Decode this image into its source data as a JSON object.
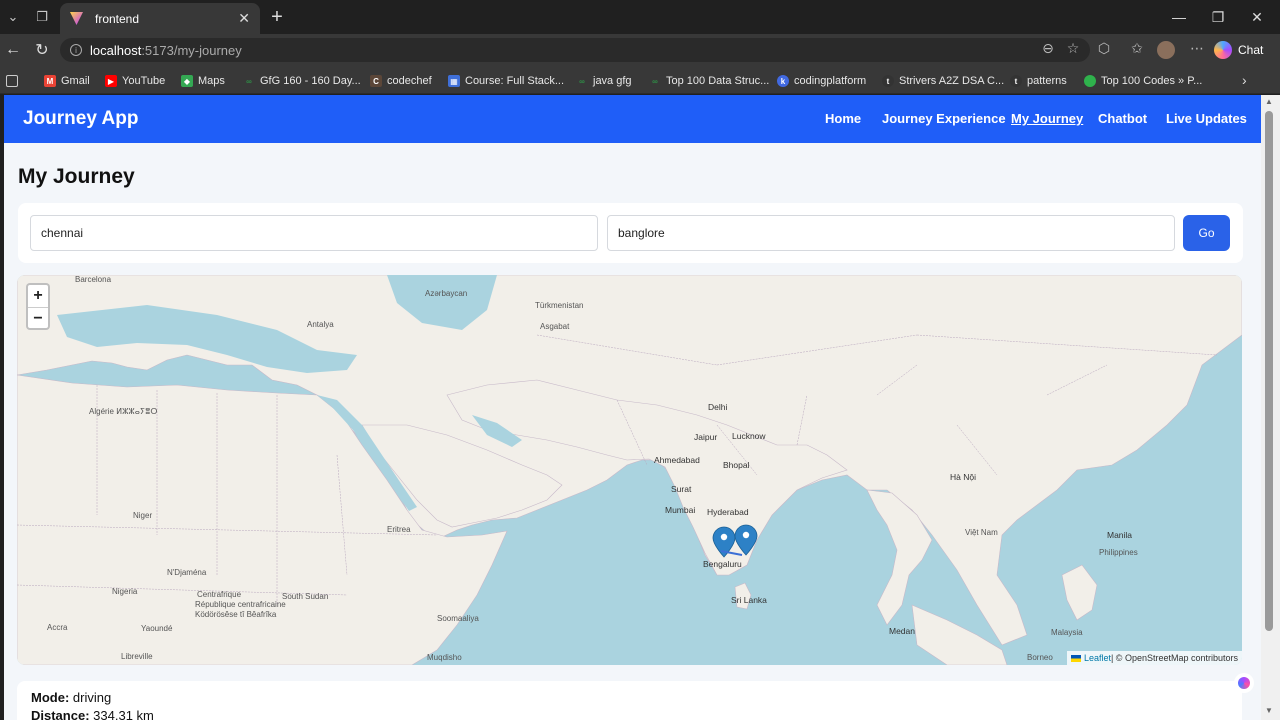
{
  "browser": {
    "tab_title": "frontend",
    "new_tab_symbol": "+",
    "url_host": "localhost",
    "url_path": ":5173/my-journey",
    "chat_label": "Chat"
  },
  "bookmarks": [
    {
      "label": "Gmail",
      "color": "#ea4335"
    },
    {
      "label": "YouTube",
      "color": "#ff0000"
    },
    {
      "label": "Maps",
      "color": "#34a853"
    },
    {
      "label": "GfG 160 - 160 Day...",
      "color": "#2f8d46"
    },
    {
      "label": "codechef",
      "color": "#5b4638"
    },
    {
      "label": "Course: Full Stack...",
      "color": "#3f6fd8"
    },
    {
      "label": "java gfg",
      "color": "#2f8d46"
    },
    {
      "label": "Top 100 Data Struc...",
      "color": "#2f8d46"
    },
    {
      "label": "codingplatform",
      "color": "#4169e1"
    },
    {
      "label": "Strivers A2Z DSA C...",
      "color": "#333333"
    },
    {
      "label": "patterns",
      "color": "#333333"
    },
    {
      "label": "Top 100 Codes » P...",
      "color": "#2fb24c"
    }
  ],
  "app": {
    "brand": "Journey App",
    "nav": [
      "Home",
      "Journey Experience",
      "My Journey",
      "Chatbot",
      "Live Updates"
    ],
    "active_nav": "My Journey",
    "primary_color": "#1f5ef8"
  },
  "page": {
    "title": "My Journey",
    "from_value": "chennai",
    "to_value": "banglore",
    "go_label": "Go"
  },
  "map": {
    "zoom_in": "+",
    "zoom_out": "−",
    "attribution_link": "Leaflet",
    "attribution_text": " | © OpenStreetMap contributors",
    "marker_color": "#2d81c6",
    "labels": {
      "turkmenistan": "Türkmenistan",
      "azerbaijan": "Azərbaycan",
      "ashgabat": "Asgabat",
      "antalya": "Antalya",
      "delhi": "Delhi",
      "jaipur": "Jaipur",
      "lucknow": "Lucknow",
      "ahmedabad": "Ahmedabad",
      "bhopal": "Bhopal",
      "surat": "Surat",
      "mumbai": "Mumbai",
      "hyderabad": "Hyderabad",
      "bengaluru": "Bengaluru",
      "sri_lanka": "Sri Lanka",
      "niger": "Niger",
      "ndjamena": "N'Djaména",
      "nigeria": "Nigeria",
      "south_sudan": "South Sudan",
      "car": "Centrafrique",
      "car2": "République centrafricaine",
      "car3": "Ködörösêse tî Bêafrîka",
      "yaounde": "Yaoundé",
      "accra": "Accra",
      "libreville": "Libreville",
      "mogadishu": "Muqdisho",
      "somalia": "Soomaaliya",
      "eritrea": "Eritrea",
      "algerie": "Algérie ⵍⵣⵣⴰⵢⴻⵔ",
      "barcelona": "Barcelona",
      "ha_noi": "Hà Nội",
      "viet_nam": "Việt Nam",
      "manila": "Manila",
      "philippines": "Philippines",
      "medan": "Medan",
      "malaysia": "Malaysia",
      "borneo": "Borneo"
    }
  },
  "journey_info": {
    "mode_label": "Mode:",
    "mode_value": "driving",
    "distance_label": "Distance:",
    "distance_value": "334.31 km"
  }
}
